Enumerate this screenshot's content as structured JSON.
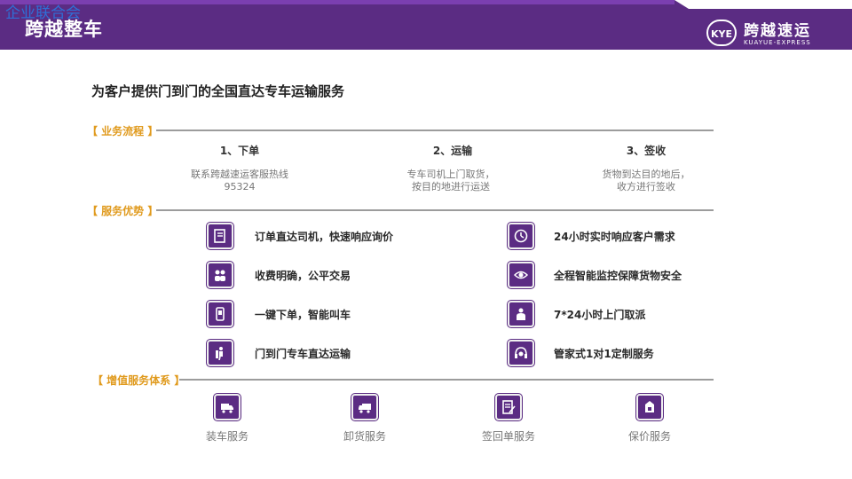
{
  "watermark": "企业联合会",
  "header": {
    "title": "跨越整车"
  },
  "logo": {
    "badge": "KYE",
    "cn": "跨越速运",
    "en": "KUAYUE-EXPRESS"
  },
  "subtitle": "为客户提供门到门的全国直达专车运输服务",
  "process": {
    "label": "【 业务流程 】",
    "steps": [
      {
        "title": "1、下单",
        "desc": [
          "联系跨越速运客服热线",
          "95324"
        ]
      },
      {
        "title": "2、运输",
        "desc": [
          "专车司机上门取货，",
          "按目的地进行运送"
        ]
      },
      {
        "title": "3、签收",
        "desc": [
          "货物到达目的地后，",
          "收方进行签收"
        ]
      }
    ]
  },
  "advantages": {
    "label": "【 服务优势 】",
    "items": [
      {
        "icon": "book-icon",
        "text": "订单直达司机，快速响应询价"
      },
      {
        "icon": "clock-icon",
        "text": "24小时实时响应客户需求"
      },
      {
        "icon": "people-icon",
        "text": "收费明确，公平交易"
      },
      {
        "icon": "eye-icon",
        "text": "全程智能监控保障货物安全"
      },
      {
        "icon": "phone-icon",
        "text": "一键下单，智能叫车"
      },
      {
        "icon": "courier-icon",
        "text": "7*24小时上门取派"
      },
      {
        "icon": "porter-icon",
        "text": "门到门专车直达运输"
      },
      {
        "icon": "headset-icon",
        "text": "管家式1对1定制服务"
      }
    ]
  },
  "value_added": {
    "label": "【 增值服务体系 】",
    "items": [
      {
        "icon": "truck-load-icon",
        "text": "装车服务"
      },
      {
        "icon": "truck-unload-icon",
        "text": "卸货服务"
      },
      {
        "icon": "receipt-icon",
        "text": "签回单服务"
      },
      {
        "icon": "insurance-icon",
        "text": "保价服务"
      }
    ]
  },
  "colors": {
    "brand": "#5b2c83",
    "accent": "#e09a1d"
  }
}
